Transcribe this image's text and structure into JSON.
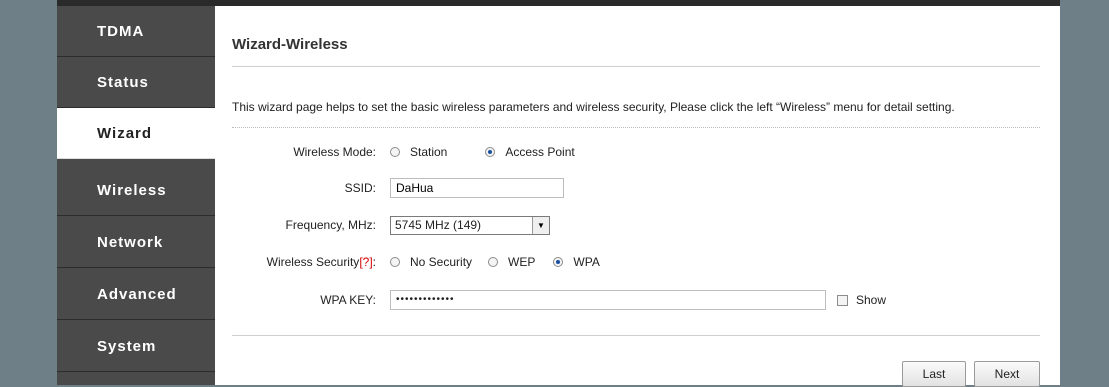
{
  "sidebar": {
    "items": [
      {
        "label": "TDMA",
        "active": false
      },
      {
        "label": "Status",
        "active": false
      },
      {
        "label": "Wizard",
        "active": true
      },
      {
        "label": "Wireless",
        "active": false
      },
      {
        "label": "Network",
        "active": false
      },
      {
        "label": "Advanced",
        "active": false
      },
      {
        "label": "System",
        "active": false
      }
    ]
  },
  "page": {
    "title": "Wizard-Wireless",
    "description": "This wizard page helps to set the basic wireless parameters and wireless security, Please click the left “Wireless” menu for detail setting."
  },
  "form": {
    "mode": {
      "label": "Wireless Mode:",
      "options": [
        "Station",
        "Access Point"
      ],
      "selected": "Access Point"
    },
    "ssid": {
      "label": "SSID:",
      "value": "DaHua"
    },
    "frequency": {
      "label": "Frequency, MHz:",
      "value": "5745 MHz (149)"
    },
    "security": {
      "label": "Wireless Security",
      "help": "[?]",
      "colon": ":",
      "options": [
        "No Security",
        "WEP",
        "WPA"
      ],
      "selected": "WPA"
    },
    "wpa_key": {
      "label": "WPA KEY:",
      "value": "•••••••••••••",
      "show_label": "Show"
    }
  },
  "buttons": {
    "last": "Last",
    "next": "Next"
  },
  "colors": {
    "sidebar_bg": "#4a4a4a",
    "page_bg": "#6e7f88",
    "help_red": "#d40000"
  }
}
